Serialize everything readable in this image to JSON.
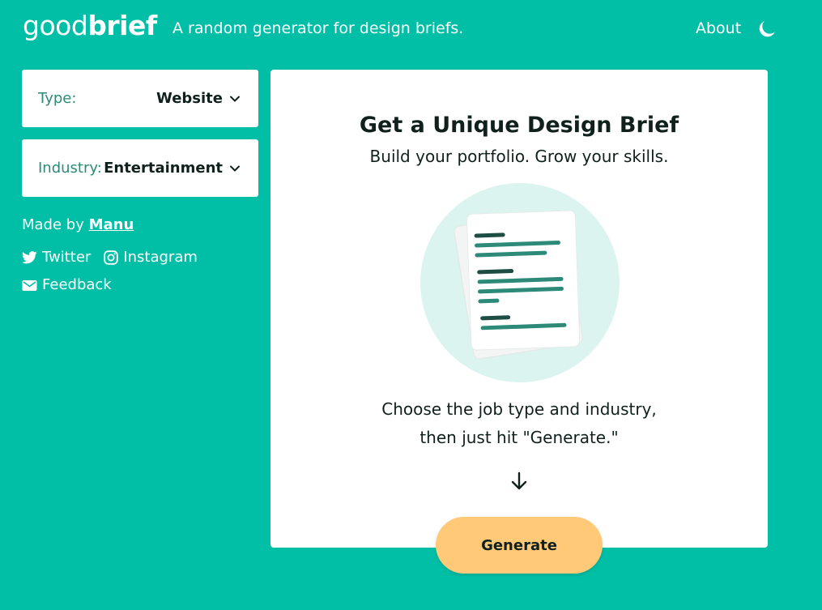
{
  "header": {
    "logo_light": "good",
    "logo_bold": "brief",
    "tagline": "A random generator for design briefs.",
    "about_label": "About",
    "theme_icon": "moon-icon"
  },
  "sidebar": {
    "type_select": {
      "label": "Type:",
      "value": "Website"
    },
    "industry_select": {
      "label": "Industry:",
      "value": "Entertainment"
    },
    "made_by_prefix": "Made by",
    "made_by_name": "Manu",
    "links": [
      {
        "label": "Twitter",
        "icon": "twitter-icon"
      },
      {
        "label": "Instagram",
        "icon": "instagram-icon"
      },
      {
        "label": "Feedback",
        "icon": "mail-icon"
      }
    ]
  },
  "main": {
    "title": "Get a Unique Design Brief",
    "subtitle": "Build your portfolio. Grow your skills.",
    "instruction_line1": "Choose the job type and industry,",
    "instruction_line2": "then just hit \"Generate.\"",
    "illustration_icon": "document-stack-icon",
    "arrow_icon": "arrow-down-icon",
    "generate_label": "Generate"
  },
  "colors": {
    "background": "#00bfa6",
    "accent_button": "#ffc978",
    "text_dark": "#10211d",
    "label_teal": "#2d8a78",
    "illustration_bg": "#dcf4f0",
    "doc_line_dark": "#1e4d44",
    "doc_line": "#2d8a78"
  }
}
